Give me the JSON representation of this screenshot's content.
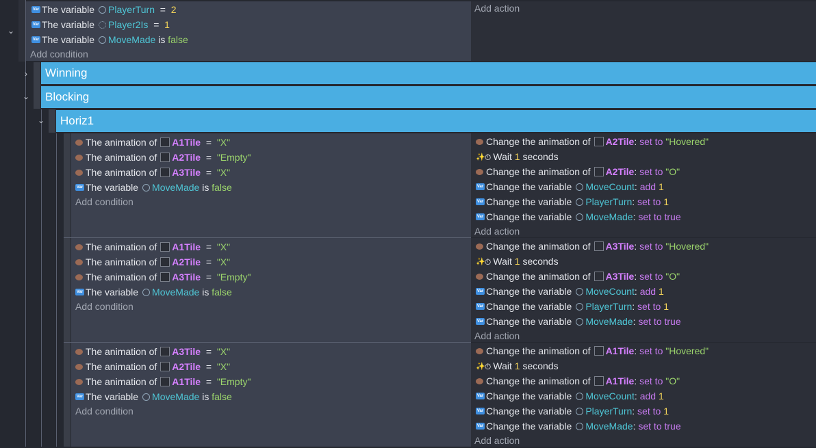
{
  "top_event": {
    "conditions": [
      {
        "icon": "variable-icon",
        "prefix": "The variable",
        "scope": "scene",
        "name": "PlayerTurn",
        "op": "=",
        "value": "2"
      },
      {
        "icon": "variable-icon",
        "prefix": "The variable",
        "scope": "global",
        "name": "Player2Is",
        "op": "=",
        "value": "1"
      },
      {
        "icon": "variable-icon",
        "prefix": "The variable",
        "scope": "scene",
        "name": "MoveMade",
        "op": "is",
        "value": "false"
      }
    ],
    "add_condition": "Add condition",
    "add_action": "Add action"
  },
  "groups": {
    "winning": "Winning",
    "blocking": "Blocking",
    "horiz1": "Horiz1"
  },
  "events": [
    {
      "conditions": [
        {
          "type": "anim",
          "prefix": "The animation of",
          "object": "A1Tile",
          "op": "=",
          "value": "\"X\""
        },
        {
          "type": "anim",
          "prefix": "The animation of",
          "object": "A2Tile",
          "op": "=",
          "value": "\"Empty\""
        },
        {
          "type": "anim",
          "prefix": "The animation of",
          "object": "A3Tile",
          "op": "=",
          "value": "\"X\""
        },
        {
          "type": "var",
          "prefix": "The variable",
          "name": "MoveMade",
          "op": "is",
          "value": "false"
        }
      ],
      "add_condition": "Add condition",
      "actions": [
        {
          "type": "anim",
          "prefix": "Change the animation of",
          "object": "A2Tile",
          "colon": ":",
          "op": "set to",
          "value": "\"Hovered\""
        },
        {
          "type": "wait",
          "prefix": "Wait",
          "value": "1",
          "suffix": "seconds"
        },
        {
          "type": "anim",
          "prefix": "Change the animation of",
          "object": "A2Tile",
          "colon": ":",
          "op": "set to",
          "value": "\"O\""
        },
        {
          "type": "var",
          "prefix": "Change the variable",
          "name": "MoveCount",
          "colon": ":",
          "op": "add",
          "value": "1"
        },
        {
          "type": "var",
          "prefix": "Change the variable",
          "name": "PlayerTurn",
          "colon": ":",
          "op": "set to",
          "value": "1"
        },
        {
          "type": "var",
          "prefix": "Change the variable",
          "name": "MoveMade",
          "colon": ":",
          "op": "set to true",
          "value": ""
        }
      ],
      "add_action": "Add action"
    },
    {
      "conditions": [
        {
          "type": "anim",
          "prefix": "The animation of",
          "object": "A1Tile",
          "op": "=",
          "value": "\"X\""
        },
        {
          "type": "anim",
          "prefix": "The animation of",
          "object": "A2Tile",
          "op": "=",
          "value": "\"X\""
        },
        {
          "type": "anim",
          "prefix": "The animation of",
          "object": "A3Tile",
          "op": "=",
          "value": "\"Empty\""
        },
        {
          "type": "var",
          "prefix": "The variable",
          "name": "MoveMade",
          "op": "is",
          "value": "false"
        }
      ],
      "add_condition": "Add condition",
      "actions": [
        {
          "type": "anim",
          "prefix": "Change the animation of",
          "object": "A3Tile",
          "colon": ":",
          "op": "set to",
          "value": "\"Hovered\""
        },
        {
          "type": "wait",
          "prefix": "Wait",
          "value": "1",
          "suffix": "seconds"
        },
        {
          "type": "anim",
          "prefix": "Change the animation of",
          "object": "A3Tile",
          "colon": ":",
          "op": "set to",
          "value": "\"O\""
        },
        {
          "type": "var",
          "prefix": "Change the variable",
          "name": "MoveCount",
          "colon": ":",
          "op": "add",
          "value": "1"
        },
        {
          "type": "var",
          "prefix": "Change the variable",
          "name": "PlayerTurn",
          "colon": ":",
          "op": "set to",
          "value": "1"
        },
        {
          "type": "var",
          "prefix": "Change the variable",
          "name": "MoveMade",
          "colon": ":",
          "op": "set to true",
          "value": ""
        }
      ],
      "add_action": "Add action"
    },
    {
      "conditions": [
        {
          "type": "anim",
          "prefix": "The animation of",
          "object": "A3Tile",
          "op": "=",
          "value": "\"X\""
        },
        {
          "type": "anim",
          "prefix": "The animation of",
          "object": "A2Tile",
          "op": "=",
          "value": "\"X\""
        },
        {
          "type": "anim",
          "prefix": "The animation of",
          "object": "A1Tile",
          "op": "=",
          "value": "\"Empty\""
        },
        {
          "type": "var",
          "prefix": "The variable",
          "name": "MoveMade",
          "op": "is",
          "value": "false"
        }
      ],
      "add_condition": "Add condition",
      "actions": [
        {
          "type": "anim",
          "prefix": "Change the animation of",
          "object": "A1Tile",
          "colon": ":",
          "op": "set to",
          "value": "\"Hovered\""
        },
        {
          "type": "wait",
          "prefix": "Wait",
          "value": "1",
          "suffix": "seconds"
        },
        {
          "type": "anim",
          "prefix": "Change the animation of",
          "object": "A1Tile",
          "colon": ":",
          "op": "set to",
          "value": "\"O\""
        },
        {
          "type": "var",
          "prefix": "Change the variable",
          "name": "MoveCount",
          "colon": ":",
          "op": "add",
          "value": "1"
        },
        {
          "type": "var",
          "prefix": "Change the variable",
          "name": "PlayerTurn",
          "colon": ":",
          "op": "set to",
          "value": "1"
        },
        {
          "type": "var",
          "prefix": "Change the variable",
          "name": "MoveMade",
          "colon": ":",
          "op": "set to true",
          "value": ""
        }
      ],
      "add_action": "Add action"
    }
  ]
}
